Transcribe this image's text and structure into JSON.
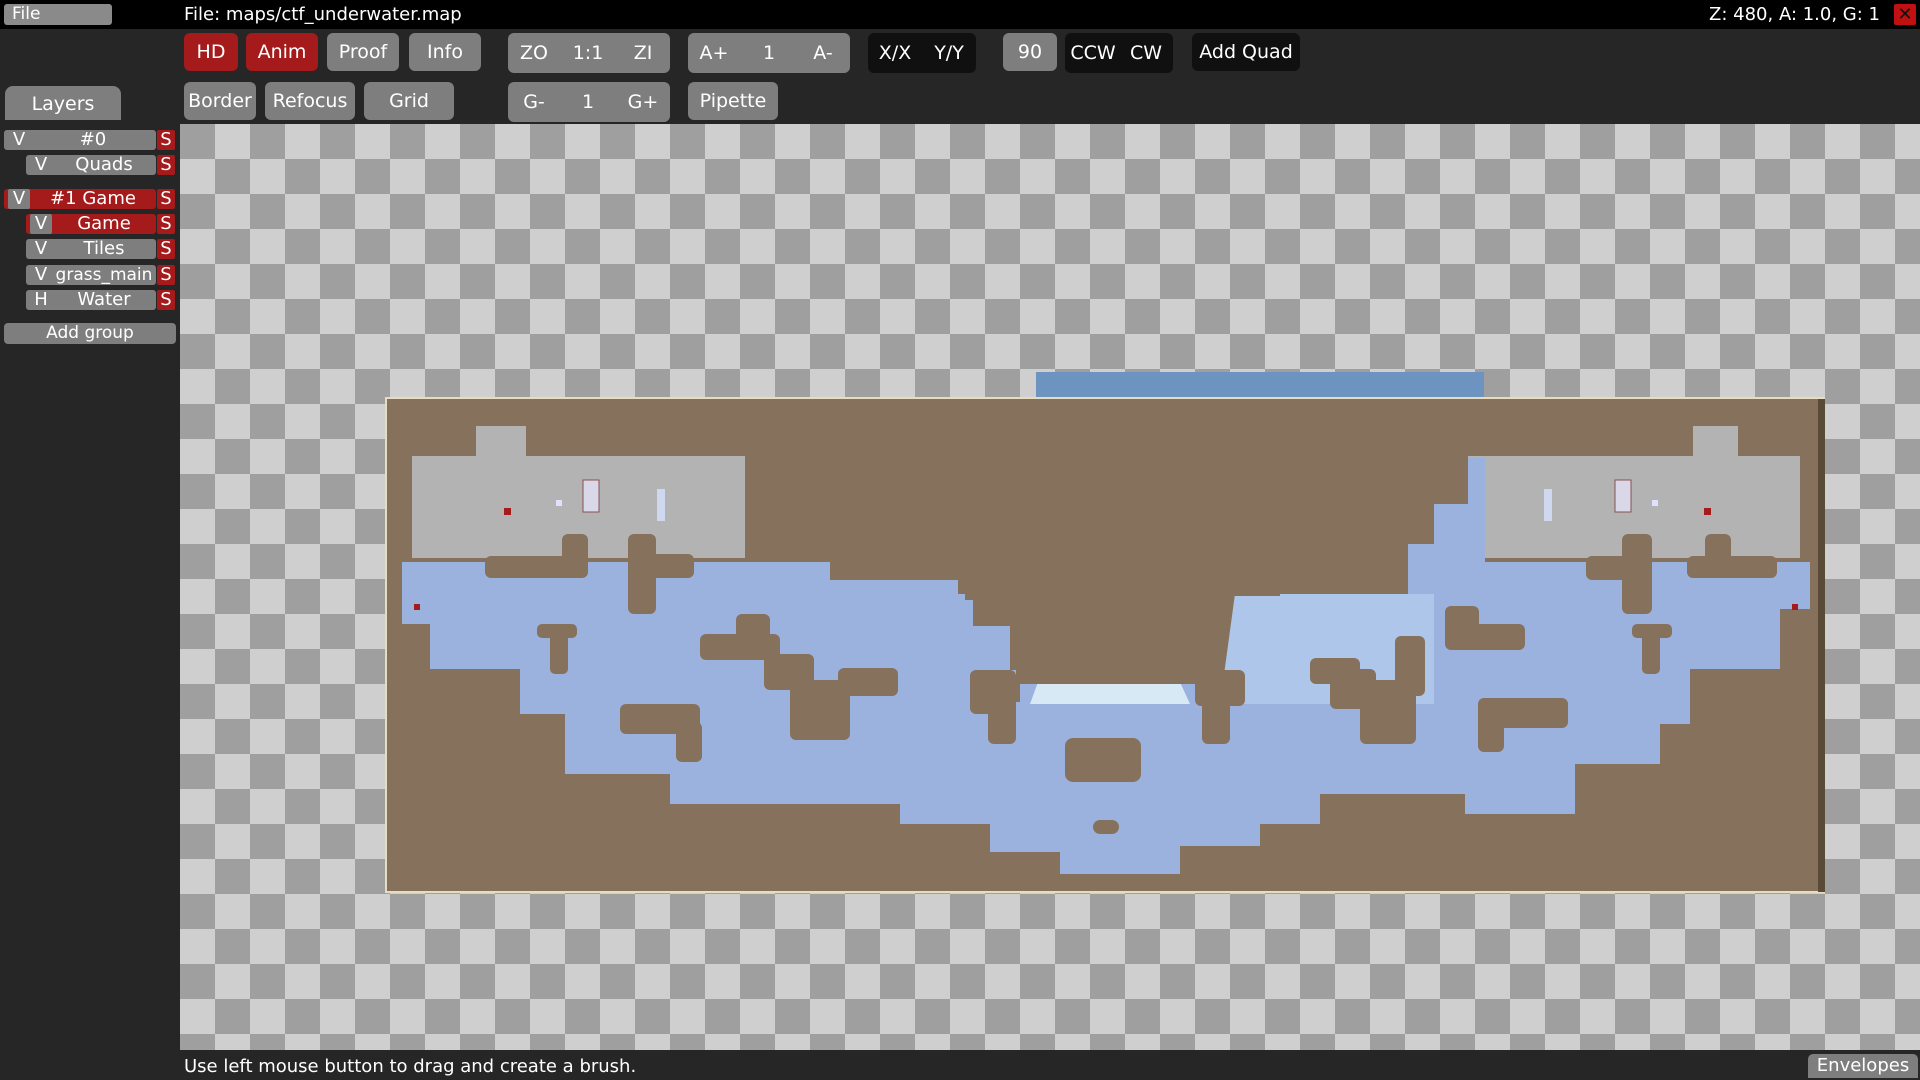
{
  "menu": {
    "file": "File"
  },
  "title": "File: maps/ctf_underwater.map",
  "status": "Z: 480, A: 1.0, G: 1",
  "close_label": "✕",
  "toolbar": {
    "hd": "HD",
    "anim": "Anim",
    "proof": "Proof",
    "info": "Info",
    "zoom_out": "ZO",
    "zoom_reset": "1:1",
    "zoom_in": "ZI",
    "anim_faster": "A+",
    "anim_speed": "1",
    "anim_slower": "A-",
    "flip_x": "X/X",
    "flip_y": "Y/Y",
    "rotate_amount": "90",
    "ccw": "CCW",
    "cw": "CW",
    "add_quad": "Add Quad",
    "border": "Border",
    "refocus": "Refocus",
    "grid": "Grid",
    "grid_minus": "G-",
    "grid_factor": "1",
    "grid_plus": "G+",
    "pipette": "Pipette"
  },
  "layers": {
    "tab": "Layers",
    "rows": [
      {
        "vis": "V",
        "name": "#0",
        "solo": "S"
      },
      {
        "vis": "V",
        "name": "Quads",
        "solo": "S"
      },
      {
        "vis": "V",
        "name": "#1 Game",
        "solo": "S"
      },
      {
        "vis": "V",
        "name": "Game",
        "solo": "S"
      },
      {
        "vis": "V",
        "name": "Tiles",
        "solo": "S"
      },
      {
        "vis": "V",
        "name": "grass_main",
        "solo": "S"
      },
      {
        "vis": "H",
        "name": "Water",
        "solo": "S"
      }
    ],
    "add_group": "Add group"
  },
  "colors": {
    "ground": "#86725c",
    "water": "#9bb2df",
    "sky": "#6d93c0",
    "active": "#a51a1a",
    "button": "#7e7e7e"
  },
  "footer": {
    "hint": "Use left mouse button to drag and create a brush.",
    "envelopes": "Envelopes"
  }
}
